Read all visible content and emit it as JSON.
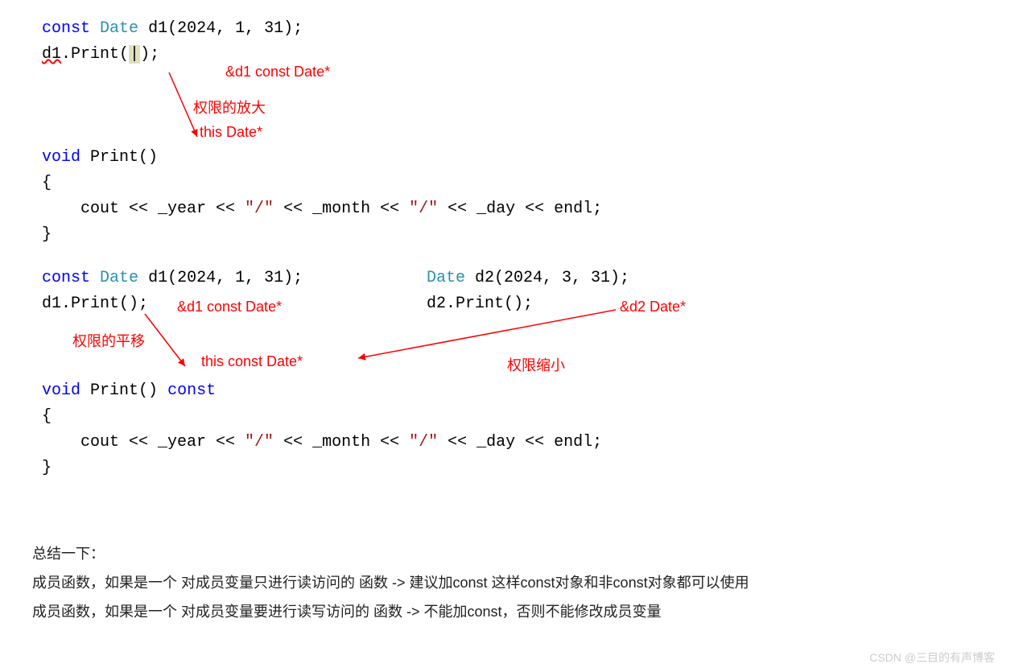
{
  "section1": {
    "line1": {
      "const": "const",
      "type": "Date",
      "rest": " d1(2024, 1, 31);"
    },
    "line2": {
      "obj": "d1",
      "dot": ".Print(",
      "cursor": "|",
      "close": ");"
    },
    "anno_addr": "&d1  const Date*",
    "anno_expand": "权限的放大",
    "anno_this": "this   Date*",
    "func_sig": {
      "void": "void",
      "name": " Print()"
    },
    "brace_open": "{",
    "cout_line": {
      "cout": "cout << _year << ",
      "s1": "\"/\"",
      "mid1": " << _month << ",
      "s2": "\"/\"",
      "mid2": " << _day << endl;"
    },
    "brace_close": "}"
  },
  "section2": {
    "left_line1": {
      "const": "const",
      "type": "Date",
      "rest": " d1(2024, 1, 31);"
    },
    "left_line2": "d1.Print();",
    "left_anno_addr": "&d1  const Date*",
    "right_line1": {
      "type": "Date",
      "rest": " d2(2024, 3, 31);"
    },
    "right_line2": "d2.Print();",
    "right_anno_addr": "&d2  Date*",
    "anno_translate": "权限的平移",
    "anno_this_const": "this  const Date*",
    "anno_shrink": "权限缩小",
    "func_sig": {
      "void": "void",
      "name": " Print() ",
      "const": "const"
    },
    "brace_open": "{",
    "cout_line": {
      "cout": "cout << _year << ",
      "s1": "\"/\"",
      "mid1": " << _month << ",
      "s2": "\"/\"",
      "mid2": " << _day << endl;"
    },
    "brace_close": "}"
  },
  "summary": {
    "title": "总结一下：",
    "line1": "成员函数，如果是一个 对成员变量只进行读访问的 函数 -> 建议加const   这样const对象和非const对象都可以使用",
    "line2": "成员函数，如果是一个 对成员变量要进行读写访问的 函数 -> 不能加const，否则不能修改成员变量"
  },
  "watermark": "CSDN @三目的有声博客"
}
